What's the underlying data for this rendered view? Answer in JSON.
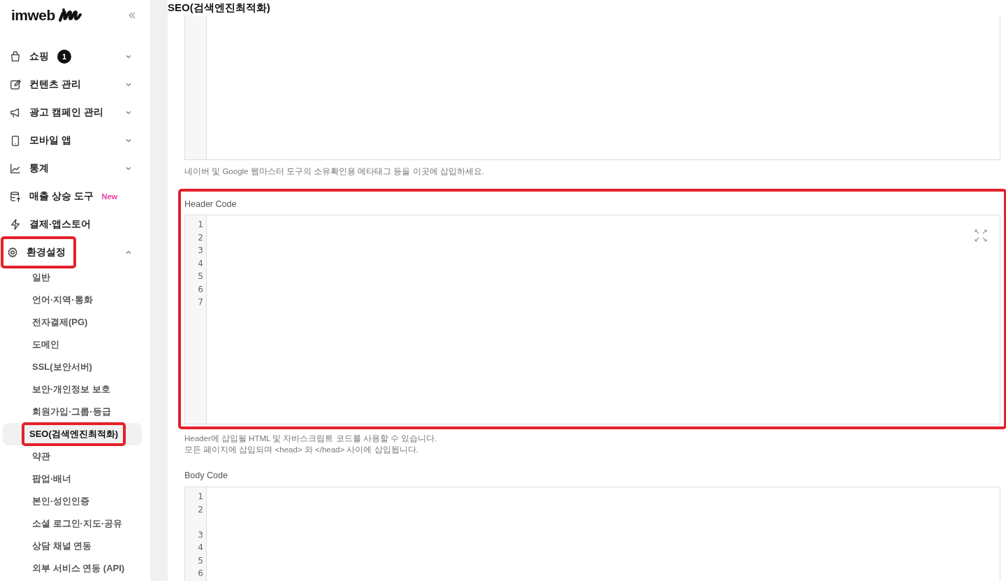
{
  "sidebar": {
    "logo": "imweb",
    "items": [
      {
        "label": "쇼핑",
        "kind": "bag",
        "badge": "1",
        "expanded": false,
        "highlighted": false
      },
      {
        "label": "컨텐츠 관리",
        "kind": "edit",
        "expanded": false,
        "highlighted": false
      },
      {
        "label": "광고 캠페인 관리",
        "kind": "megaphone",
        "expanded": false,
        "highlighted": false
      },
      {
        "label": "모바일 앱",
        "kind": "phone",
        "expanded": false,
        "highlighted": false
      },
      {
        "label": "통계",
        "kind": "chart",
        "expanded": false,
        "highlighted": false
      },
      {
        "label": "매출 상승 도구",
        "kind": "stack",
        "tag": "New",
        "highlighted": false
      },
      {
        "label": "결제·앱스토어",
        "kind": "bolt",
        "highlighted": false
      },
      {
        "label": "환경설정",
        "kind": "gear",
        "expanded": true,
        "highlighted": true,
        "children": [
          {
            "label": "일반",
            "selected": false,
            "highlighted": false
          },
          {
            "label": "언어·지역·통화",
            "selected": false,
            "highlighted": false
          },
          {
            "label": "전자결제(PG)",
            "selected": false,
            "highlighted": false
          },
          {
            "label": "도메인",
            "selected": false,
            "highlighted": false
          },
          {
            "label": "SSL(보안서버)",
            "selected": false,
            "highlighted": false
          },
          {
            "label": "보안·개인정보 보호",
            "selected": false,
            "highlighted": false
          },
          {
            "label": "회원가입·그룹·등급",
            "selected": false,
            "highlighted": false
          },
          {
            "label": "SEO(검색엔진최적화)",
            "selected": true,
            "highlighted": true
          },
          {
            "label": "약관",
            "selected": false,
            "highlighted": false
          },
          {
            "label": "팝업·배너",
            "selected": false,
            "highlighted": false
          },
          {
            "label": "본인·성인인증",
            "selected": false,
            "highlighted": false
          },
          {
            "label": "소셜 로그인·지도·공유",
            "selected": false,
            "highlighted": false
          },
          {
            "label": "상담 채널 연동",
            "selected": false,
            "highlighted": false
          },
          {
            "label": "외부 서비스 연동 (API)",
            "selected": false,
            "highlighted": false
          }
        ]
      }
    ]
  },
  "page_title": "SEO(검색엔진최적화)",
  "sections": [
    {
      "help": [
        "네이버 및 Google 웹마스터 도구의 소유확인용 메타태그 등을 이곳에 삽입하세요."
      ],
      "highlighted": false
    },
    {
      "label": "Header Code",
      "lines": [
        {
          "number": "1"
        },
        {
          "number": "2"
        },
        {
          "number": "3"
        },
        {
          "number": "4"
        },
        {
          "number": "5"
        },
        {
          "number": "6"
        },
        {
          "number": "7"
        }
      ],
      "expand_button": true,
      "highlighted": true,
      "help": [
        "Header에 삽입될 HTML 및 자바스크립트 코드를 사용할 수 있습니다.",
        "모든 페이지에 삽입되며 <head> 와 </head> 사이에 삽입됩니다."
      ]
    },
    {
      "label": "Body Code",
      "lines": [
        {
          "number": "1"
        },
        {
          "number": "2",
          "wrapped": true
        },
        {
          "number": "3"
        },
        {
          "number": "4"
        },
        {
          "number": "5"
        },
        {
          "number": "6"
        }
      ],
      "highlighted": false
    }
  ]
}
